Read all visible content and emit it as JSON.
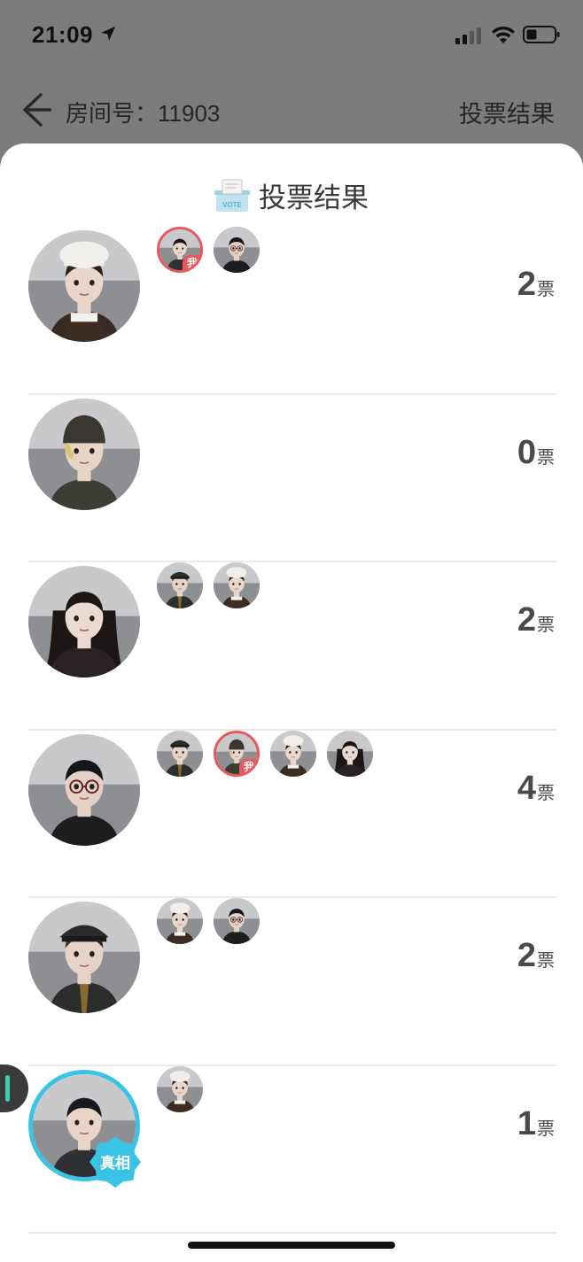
{
  "status_bar": {
    "time": "21:09",
    "icons": [
      "location-arrow-icon",
      "signal-icon",
      "wifi-icon",
      "battery-icon"
    ]
  },
  "nav": {
    "room_label": "房间号：11903",
    "right_title": "投票结果",
    "back_icon": "back-arrow-icon"
  },
  "sheet": {
    "title": "投票结果",
    "title_icon": "vote-box-icon",
    "title_icon_text": "VOTE"
  },
  "players": [
    {
      "character": "chef",
      "votes": "2",
      "voters": [
        {
          "character": "teen-boy",
          "is_me": true
        },
        {
          "character": "glasses-boy",
          "is_me": false
        }
      ]
    },
    {
      "character": "beanie-boy",
      "votes": "0",
      "voters": []
    },
    {
      "character": "long-hair-girl",
      "votes": "2",
      "voters": [
        {
          "character": "officer",
          "is_me": false
        },
        {
          "character": "chef",
          "is_me": false
        }
      ]
    },
    {
      "character": "glasses-boy",
      "votes": "4",
      "voters": [
        {
          "character": "officer",
          "is_me": false
        },
        {
          "character": "beanie-boy",
          "is_me": true
        },
        {
          "character": "chef",
          "is_me": false
        },
        {
          "character": "long-hair-girl",
          "is_me": false
        }
      ]
    },
    {
      "character": "officer",
      "votes": "2",
      "voters": [
        {
          "character": "chef",
          "is_me": false
        },
        {
          "character": "glasses-boy",
          "is_me": false
        }
      ]
    },
    {
      "character": "teen-boy",
      "votes": "1",
      "truth": true,
      "voters": [
        {
          "character": "chef",
          "is_me": false
        }
      ]
    }
  ],
  "labels": {
    "vote_unit": "票",
    "me_tag": "我",
    "truth_tag": "真相"
  },
  "colors": {
    "me_ring": "#e8575d",
    "truth_ring": "#39c3e4",
    "overlay": "#7c7c7c",
    "handle_accent": "#39d0b0"
  }
}
